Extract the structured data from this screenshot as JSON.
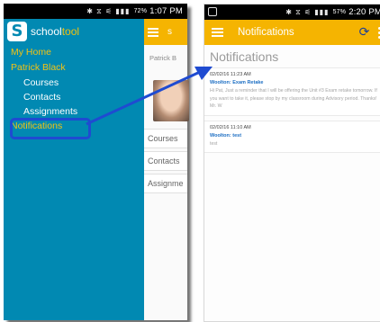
{
  "left_phone": {
    "status": {
      "icons": "✱ ⧖ ⚟ ▮▮▮",
      "battery": "72%",
      "time": "1:07 PM"
    },
    "brand": {
      "name_plain": "school",
      "name_accent": "tool",
      "logo_letter": "S"
    },
    "nav": [
      {
        "label": "My Home",
        "level": 1
      },
      {
        "label": "Patrick Black",
        "level": 1
      },
      {
        "label": "Courses",
        "level": 2
      },
      {
        "label": "Contacts",
        "level": 2
      },
      {
        "label": "Assignments",
        "level": 2
      }
    ],
    "notifications_item": "Notifications",
    "peek": {
      "title_fragment": "s",
      "student_name": "Patrick B",
      "cards": [
        "Courses",
        "Contacts",
        "Assignme"
      ]
    }
  },
  "right_phone": {
    "status": {
      "icons": "✱ ⧖ ⚟ ▮▮▮",
      "battery": "57%",
      "time": "2:20 PM"
    },
    "appbar_title": "Notifications",
    "page_title": "Notifications",
    "notifications": [
      {
        "date": "02/02/16 11:23 AM",
        "subject": "Woolton: Exam Retake",
        "text": "Hi Pat, Just a reminder that I will be offering the Unit #3 Exam retake tomorrow. If you want to take it, please stop by my classroom during Advisory period. Thanks! Mr. W"
      },
      {
        "date": "02/02/16 11:10 AM",
        "subject": "Woolton: test",
        "text": "test"
      }
    ]
  },
  "colors": {
    "drawer": "#0189b2",
    "appbar": "#f5b401",
    "nav_highlight": "#f3c314",
    "callout": "#1f4bd1"
  }
}
